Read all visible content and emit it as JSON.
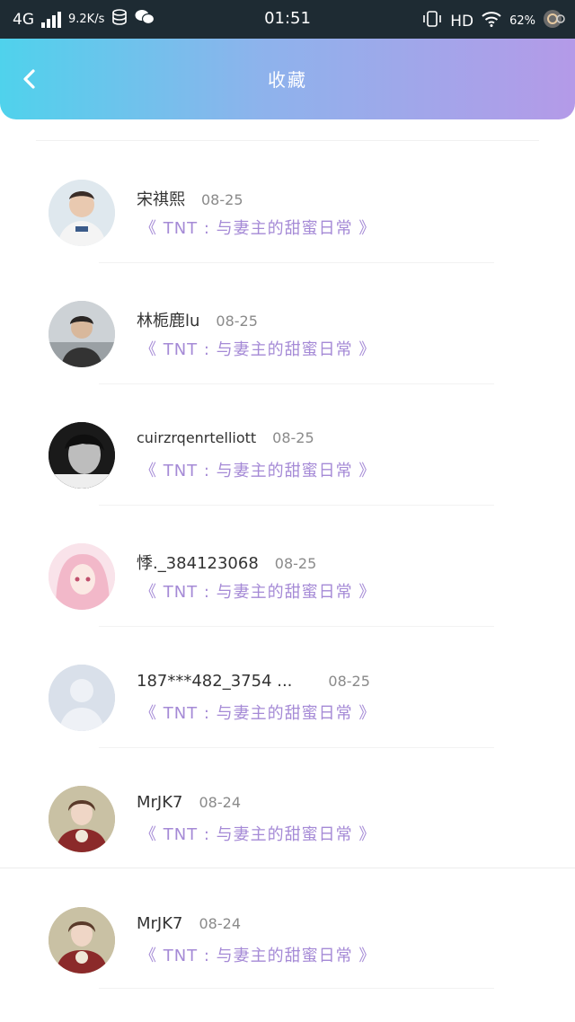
{
  "status_bar": {
    "network": "4G",
    "speed": "9.2K/s",
    "time": "01:51",
    "hd": "HD",
    "battery": "62%"
  },
  "header": {
    "title": "收藏",
    "back_icon": "chevron-left-icon",
    "colors": [
      "#4fd2ec",
      "#b49ae8"
    ]
  },
  "items": [
    {
      "name": "宋祺熙",
      "date": "08-25",
      "book": "《 TNT : 与妻主的甜蜜日常 》"
    },
    {
      "name": "林栀鹿lu",
      "date": "08-25",
      "book": "《 TNT : 与妻主的甜蜜日常 》"
    },
    {
      "name": "cuirzrqenrtelliott",
      "date": "08-25",
      "book": "《 TNT : 与妻主的甜蜜日常 》"
    },
    {
      "name": "悸._384123068",
      "date": "08-25",
      "book": "《 TNT : 与妻主的甜蜜日常 》"
    },
    {
      "name": "187***482_3754 ...",
      "date": "08-25",
      "book": "《 TNT : 与妻主的甜蜜日常 》"
    },
    {
      "name": "MrJK7",
      "date": "08-24",
      "book": "《 TNT : 与妻主的甜蜜日常 》"
    },
    {
      "name": "MrJK7",
      "date": "08-24",
      "book": "《 TNT : 与妻主的甜蜜日常 》"
    }
  ]
}
